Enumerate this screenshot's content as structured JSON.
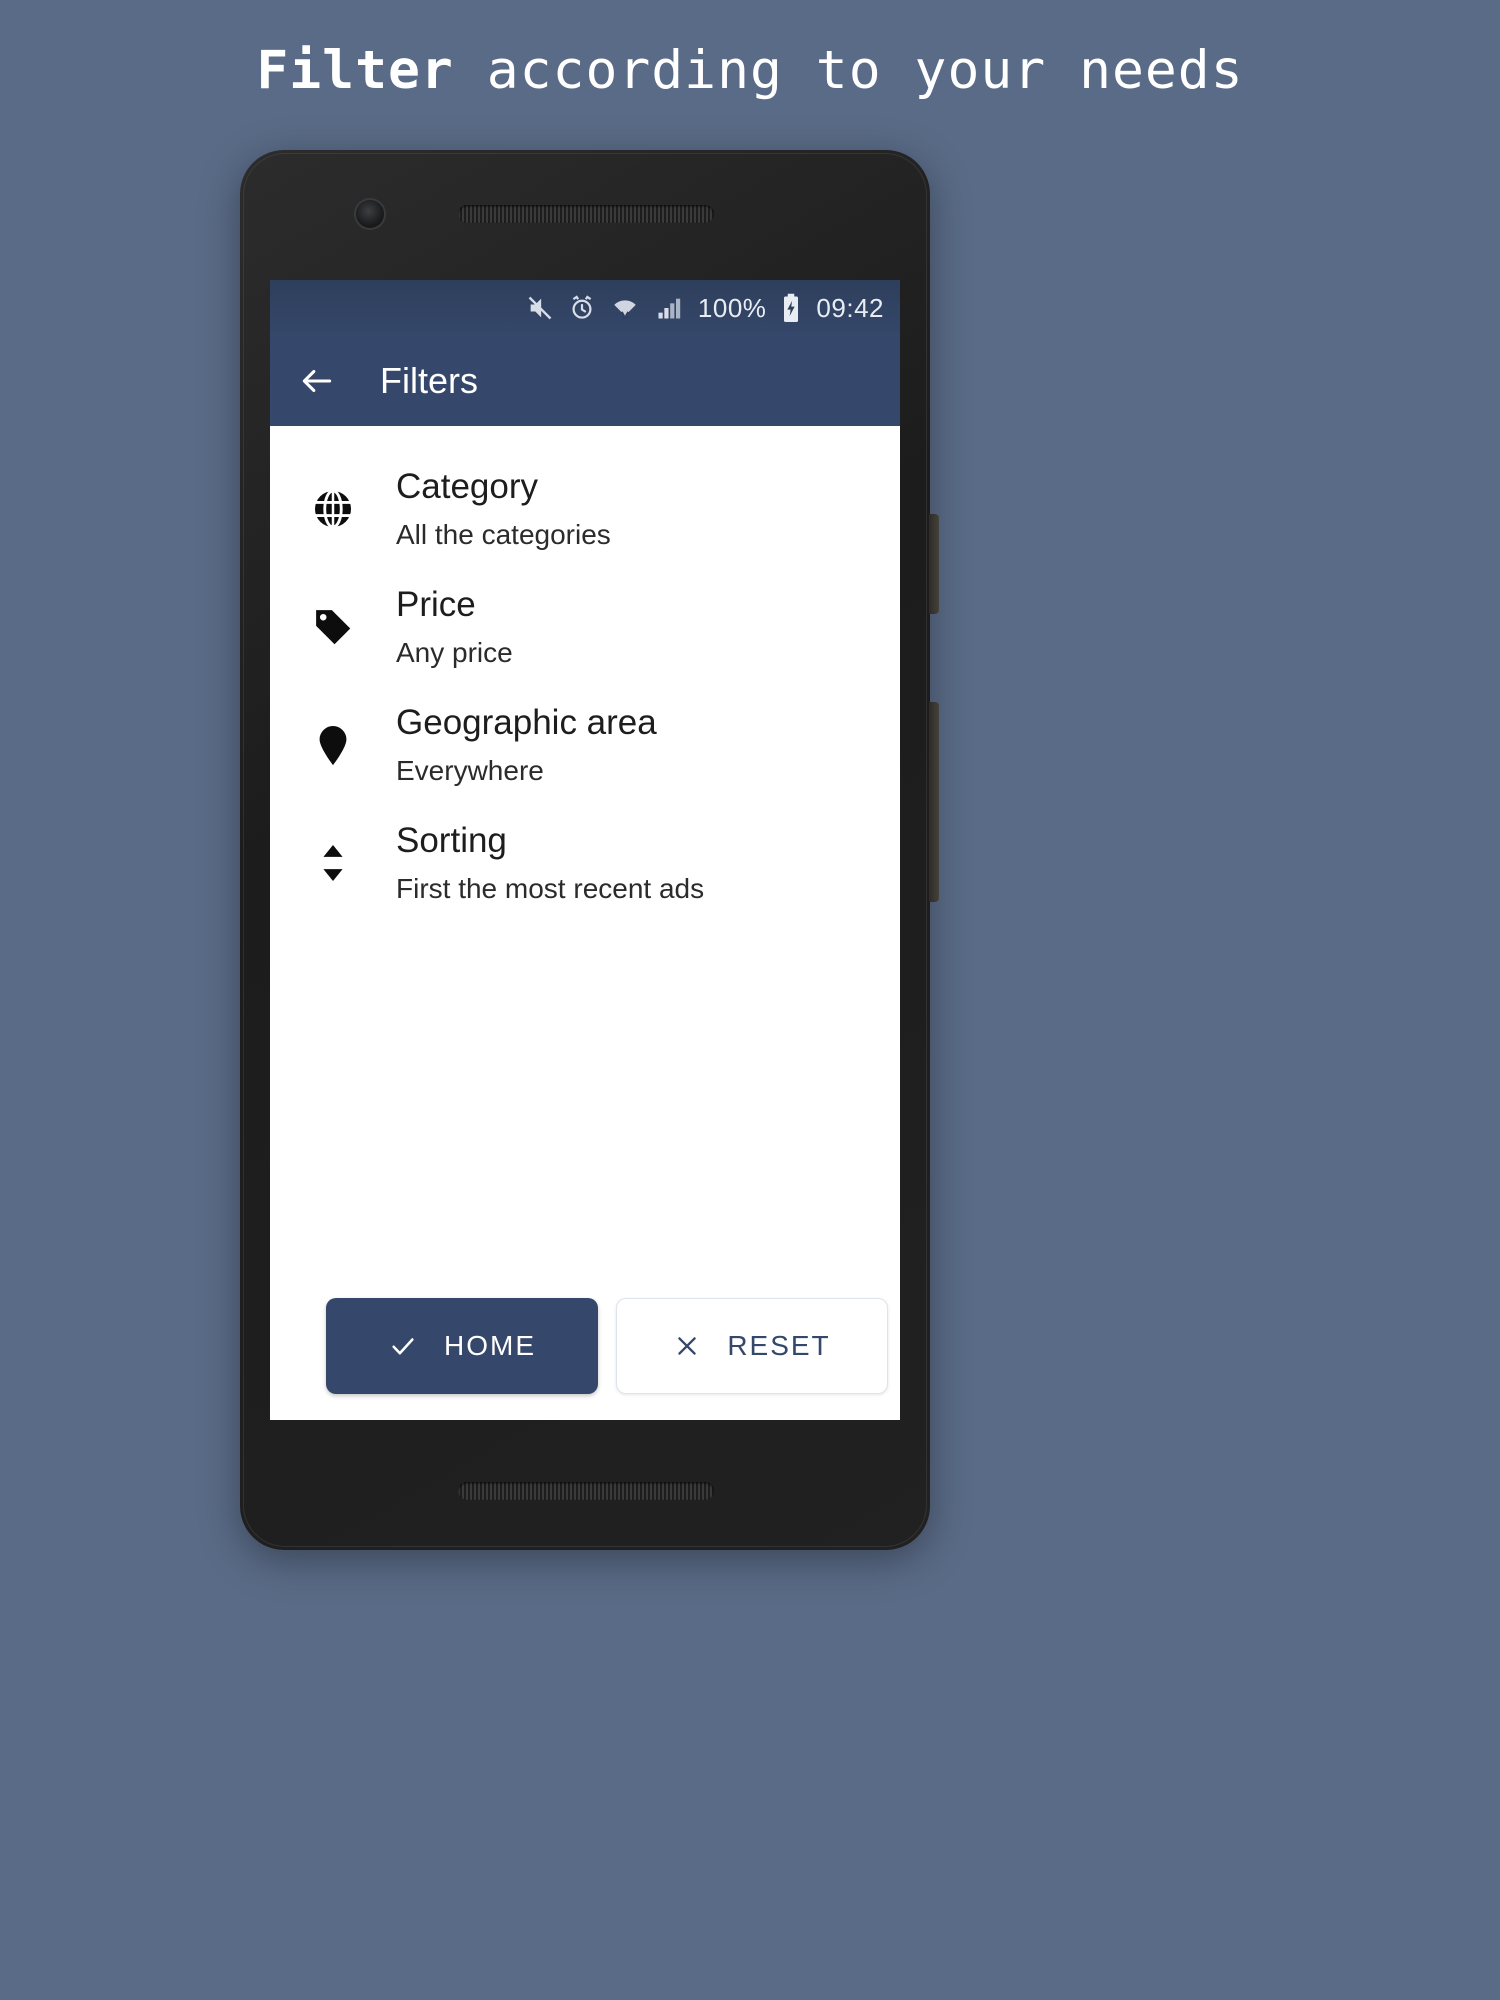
{
  "headline": {
    "emphasis": "Filter",
    "rest": " according to your needs"
  },
  "colors": {
    "background": "#5a6b87",
    "accent": "#35476a",
    "statusbar": "#2e3f5c",
    "screen": "#ffffff"
  },
  "phone": {
    "camera_icon": "front-camera",
    "earpiece_icon": "earpiece-speaker",
    "bottom_speaker_icon": "bottom-speaker",
    "power_button": "power-button",
    "volume_button": "volume-button"
  },
  "statusbar": {
    "icons": [
      "mute-icon",
      "alarm-icon",
      "wifi-icon",
      "signal-icon"
    ],
    "battery_percent": "100%",
    "battery_icon": "battery-charging-icon",
    "time": "09:42"
  },
  "appbar": {
    "back_icon": "back-arrow-icon",
    "title": "Filters"
  },
  "filters": [
    {
      "icon": "globe-icon",
      "label": "Category",
      "value": "All the categories"
    },
    {
      "icon": "price-tag-icon",
      "label": "Price",
      "value": "Any price"
    },
    {
      "icon": "map-pin-icon",
      "label": "Geographic area",
      "value": "Everywhere"
    },
    {
      "icon": "sort-icon",
      "label": "Sorting",
      "value": "First the most recent ads"
    }
  ],
  "actions": {
    "home": {
      "label": "HOME",
      "icon": "check-icon"
    },
    "reset": {
      "label": "RESET",
      "icon": "close-icon"
    }
  }
}
